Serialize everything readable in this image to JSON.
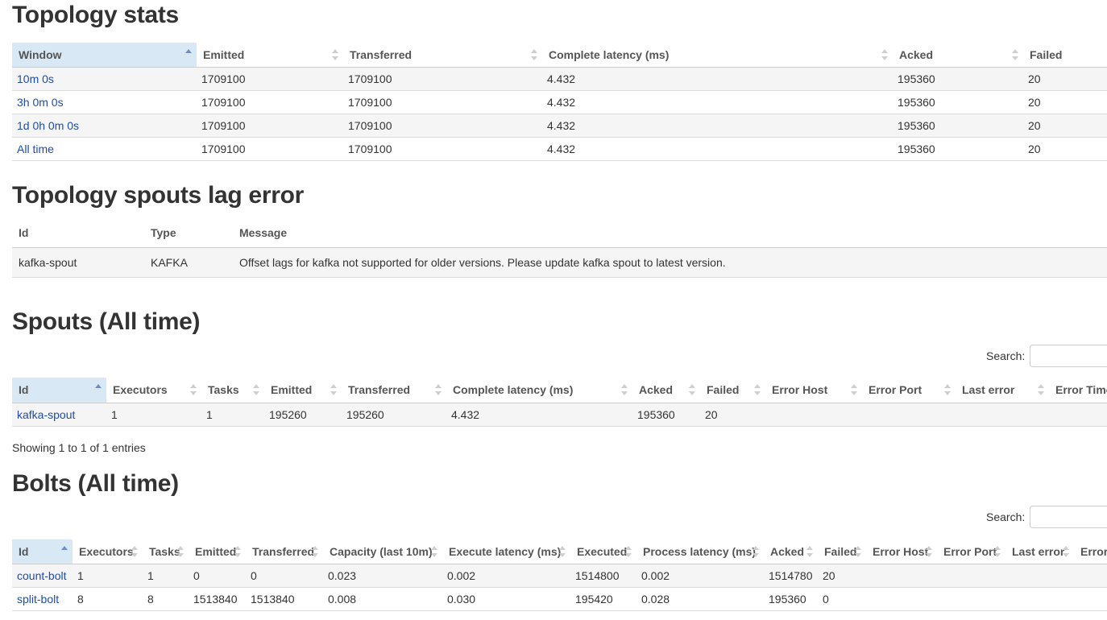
{
  "topology_stats": {
    "title": "Topology stats",
    "columns": [
      "Window",
      "Emitted",
      "Transferred",
      "Complete latency (ms)",
      "Acked",
      "Failed"
    ],
    "rows": [
      [
        "10m 0s",
        "1709100",
        "1709100",
        "4.432",
        "195360",
        "20"
      ],
      [
        "3h 0m 0s",
        "1709100",
        "1709100",
        "4.432",
        "195360",
        "20"
      ],
      [
        "1d 0h 0m 0s",
        "1709100",
        "1709100",
        "4.432",
        "195360",
        "20"
      ],
      [
        "All time",
        "1709100",
        "1709100",
        "4.432",
        "195360",
        "20"
      ]
    ]
  },
  "spouts_lag": {
    "title": "Topology spouts lag error",
    "columns": [
      "Id",
      "Type",
      "Message"
    ],
    "rows": [
      [
        "kafka-spout",
        "KAFKA",
        "Offset lags for kafka not supported for older versions. Please update kafka spout to latest version."
      ]
    ]
  },
  "spouts": {
    "title": "Spouts (All time)",
    "search_label": "Search:",
    "columns": [
      "Id",
      "Executors",
      "Tasks",
      "Emitted",
      "Transferred",
      "Complete latency (ms)",
      "Acked",
      "Failed",
      "Error Host",
      "Error Port",
      "Last error",
      "Error Time"
    ],
    "rows": [
      [
        "kafka-spout",
        "1",
        "1",
        "195260",
        "195260",
        "4.432",
        "195360",
        "20",
        "",
        "",
        "",
        ""
      ]
    ],
    "info": "Showing 1 to 1 of 1 entries"
  },
  "bolts": {
    "title": "Bolts (All time)",
    "search_label": "Search:",
    "columns": [
      "Id",
      "Executors",
      "Tasks",
      "Emitted",
      "Transferred",
      "Capacity (last 10m)",
      "Execute latency (ms)",
      "Executed",
      "Process latency (ms)",
      "Acked",
      "Failed",
      "Error Host",
      "Error Port",
      "Last error",
      "Error Time"
    ],
    "rows": [
      [
        "count-bolt",
        "1",
        "1",
        "0",
        "0",
        "0.023",
        "0.002",
        "1514800",
        "0.002",
        "1514780",
        "20",
        "",
        "",
        "",
        ""
      ],
      [
        "split-bolt",
        "8",
        "8",
        "1513840",
        "1513840",
        "0.008",
        "0.030",
        "195420",
        "0.028",
        "195360",
        "0",
        "",
        "",
        "",
        ""
      ]
    ]
  }
}
